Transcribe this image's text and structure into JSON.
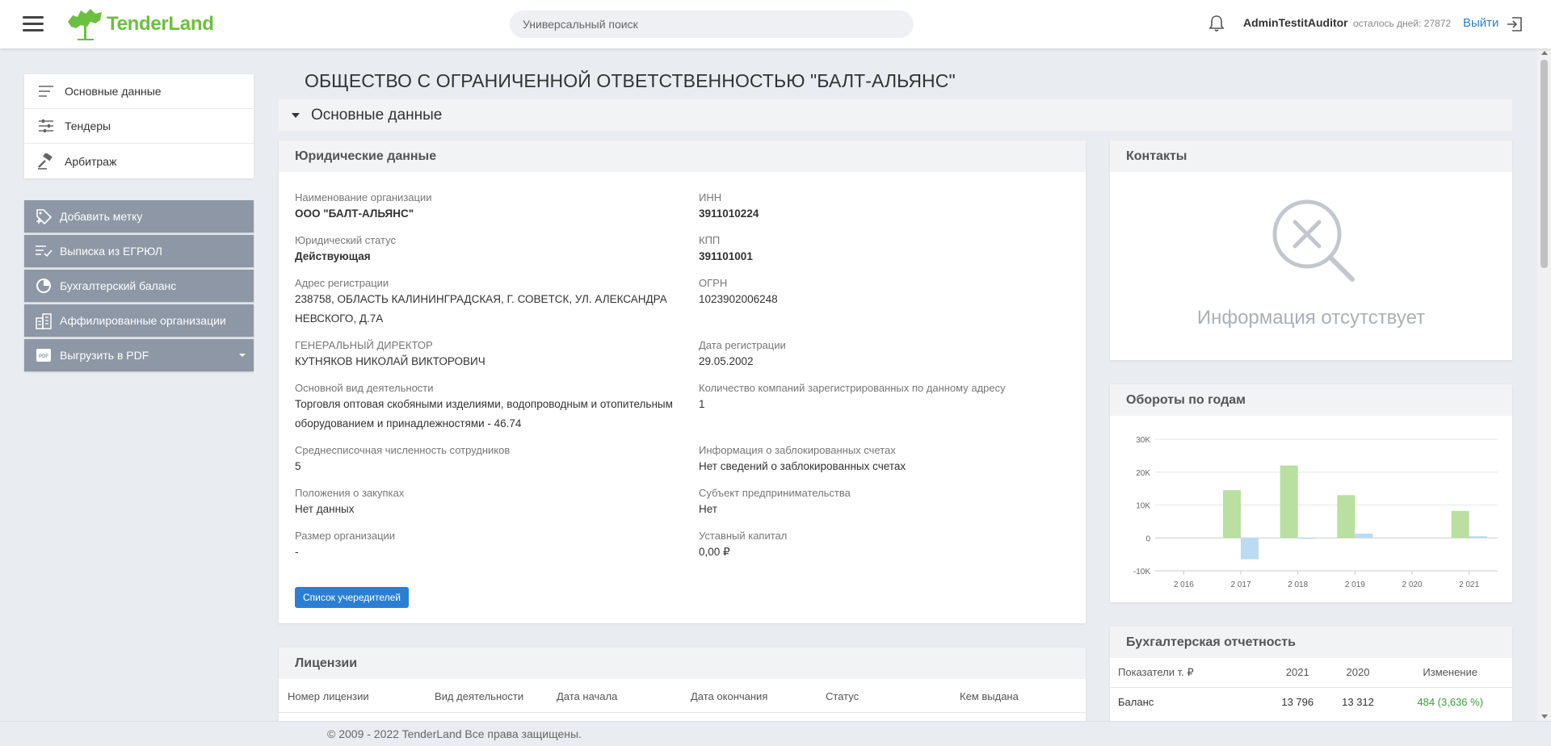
{
  "header": {
    "logo_text": "TenderLand",
    "search_placeholder": "Универсальный поиск",
    "username": "AdminTestitAuditor",
    "days_left": "осталось дней: 27872",
    "logout_label": "Выйти"
  },
  "sidebar": {
    "items": [
      {
        "label": "Основные данные",
        "icon": "list-icon"
      },
      {
        "label": "Тендеры",
        "icon": "sliders-icon"
      },
      {
        "label": "Арбитраж",
        "icon": "gavel-icon"
      }
    ],
    "actions": [
      {
        "label": "Добавить метку",
        "icon": "tag-add-icon"
      },
      {
        "label": "Выписка из ЕГРЮЛ",
        "icon": "list-check-icon"
      },
      {
        "label": "Бухгалтерский баланс",
        "icon": "pie-chart-icon"
      },
      {
        "label": "Аффилированные организации",
        "icon": "buildings-icon"
      },
      {
        "label": "Выгрузить в PDF",
        "icon": "pdf-icon"
      }
    ]
  },
  "page": {
    "title": "ОБЩЕСТВО С ОГРАНИЧЕННОЙ ОТВЕТСТВЕННОСТЬЮ \"БАЛТ-АЛЬЯНС\"",
    "section_title": "Основные данные"
  },
  "legal": {
    "title": "Юридические данные",
    "fields": {
      "org_name": {
        "label": "Наименование организации",
        "value": "ООО \"БАЛТ-АЛЬЯНС\""
      },
      "inn": {
        "label": "ИНН",
        "value": "3911010224"
      },
      "status": {
        "label": "Юридический статус",
        "value": "Действующая"
      },
      "kpp": {
        "label": "КПП",
        "value": "391101001"
      },
      "address": {
        "label": "Адрес регистрации",
        "value": "238758, ОБЛАСТЬ КАЛИНИНГРАДСКАЯ, Г. СОВЕТСК, УЛ. АЛЕКСАНДРА НЕВСКОГО, Д.7А"
      },
      "ogrn": {
        "label": "ОГРН",
        "value": "1023902006248"
      },
      "director": {
        "label": "ГЕНЕРАЛЬНЫЙ ДИРЕКТОР",
        "value": "КУТНЯКОВ НИКОЛАЙ ВИКТОРОВИЧ"
      },
      "reg_date": {
        "label": "Дата регистрации",
        "value": "29.05.2002"
      },
      "activity": {
        "label": "Основной вид деятельности",
        "value": "Торговля оптовая скобяными изделиями, водопроводным и отопительным оборудованием и принадлежностями - 46.74"
      },
      "companies_at_address": {
        "label": "Количество компаний зарегистрированных по данному адресу",
        "value": "1"
      },
      "employees": {
        "label": "Среднесписочная численность сотрудников",
        "value": "5"
      },
      "blocked_accounts": {
        "label": "Информация о заблокированных счетах",
        "value": "Нет сведений о заблокированных счетах"
      },
      "procurement": {
        "label": "Положения о закупках",
        "value": "Нет данных"
      },
      "sme": {
        "label": "Субъект предпринимательства",
        "value": "Нет"
      },
      "size": {
        "label": "Размер организации",
        "value": "-"
      },
      "capital": {
        "label": "Уставный капитал",
        "value": "0,00 ₽"
      }
    },
    "founders_button": "Список учередителей"
  },
  "contacts": {
    "title": "Контакты",
    "empty_text": "Информация отсутствует",
    "empty_icon": "search-x-icon"
  },
  "turnover": {
    "title": "Обороты по годам"
  },
  "chart_data": {
    "type": "bar",
    "categories": [
      "2 016",
      "2 017",
      "2 018",
      "2 019",
      "2 020",
      "2 021"
    ],
    "y_ticks": [
      "30K",
      "20K",
      "10K",
      "0",
      "-10K"
    ],
    "ylim": [
      -10000,
      30000
    ],
    "grid": true,
    "series": [
      {
        "color": "#b9dfa1",
        "values": [
          0,
          14500,
          22000,
          13000,
          0,
          8200
        ]
      },
      {
        "color": "#bcdaf0",
        "values": [
          0,
          -6500,
          -300,
          1300,
          0,
          500
        ]
      }
    ]
  },
  "accounting": {
    "title": "Бухгалтерская отчетность",
    "headers": [
      "Показатели т. ₽",
      "2021",
      "2020",
      "Изменение"
    ],
    "rows": [
      [
        "Баланс",
        "13 796",
        "13 312",
        "484 (3,636 %)"
      ]
    ]
  },
  "licenses": {
    "title": "Лицензии",
    "columns": [
      "Номер лицензии",
      "Вид деятельности",
      "Дата начала",
      "Дата окончания",
      "Статус",
      "Кем выдана"
    ]
  },
  "footer": {
    "text": "© 2009 - 2022 TenderLand Все права защищены."
  },
  "colors": {
    "brand_green": "#6cbf3f",
    "link_blue": "#2a7fd4",
    "action_gray": "#8d97a5",
    "positive_green": "#3aa03a"
  }
}
